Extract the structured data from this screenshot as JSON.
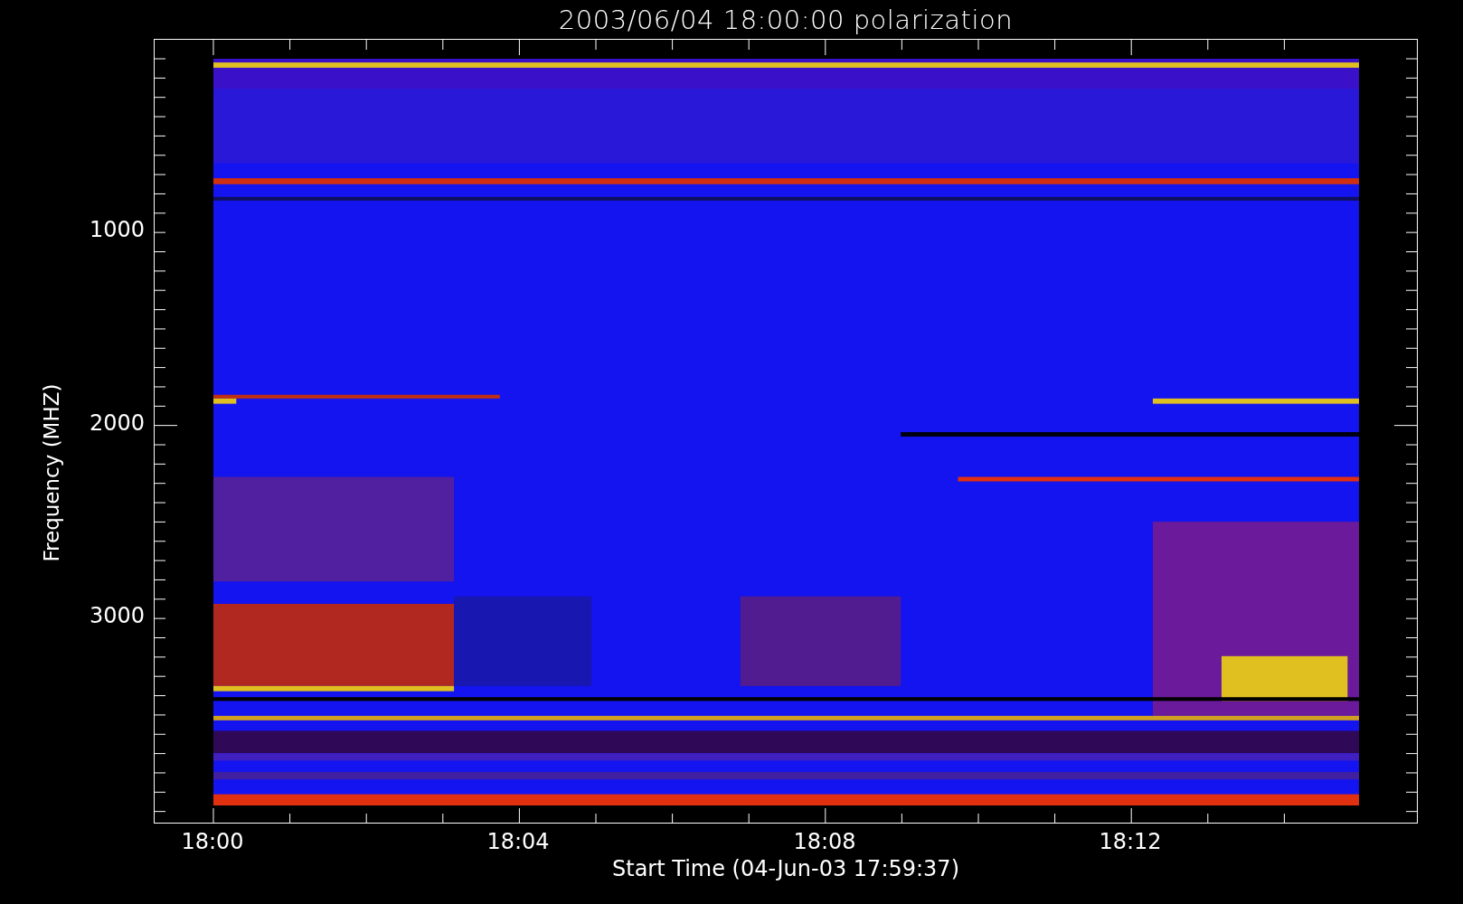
{
  "title": "2003/06/04 18:00:00 polarization",
  "x_axis": {
    "label": "Start Time (04-Jun-03 17:59:37)",
    "ticks": [
      {
        "label": "18:00"
      },
      {
        "label": "18:04"
      },
      {
        "label": "18:08"
      },
      {
        "label": "18:12"
      }
    ]
  },
  "y_axis": {
    "label": "Frequency (MHZ)",
    "ticks": [
      {
        "label": "1000"
      },
      {
        "label": "2000"
      },
      {
        "label": "3000"
      }
    ]
  }
}
